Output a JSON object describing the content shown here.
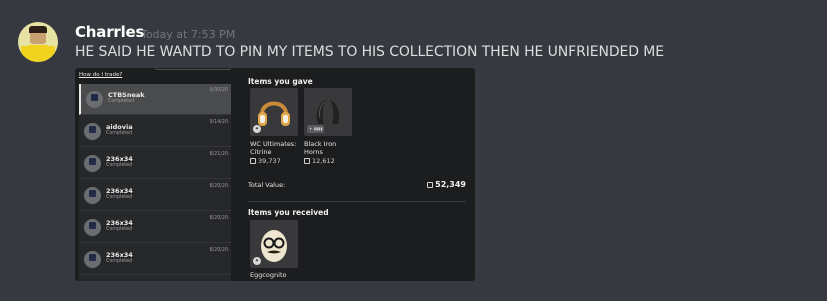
{
  "message": {
    "username": "Charrles",
    "timestamp": "Today at 7:53 PM",
    "text": "HE SAID HE WANTD TO PIN MY ITEMS TO HIS COLLECTION THEN HE UNFRIENDED ME"
  },
  "screenshot": {
    "help_link": "How do I trade?",
    "trades": [
      {
        "name": "CTBSneak",
        "status": "Completed",
        "date": "9/30/20",
        "selected": true
      },
      {
        "name": "aidovia",
        "status": "Completed",
        "date": "9/14/20",
        "selected": false
      },
      {
        "name": "236x34",
        "status": "Completed",
        "date": "8/21/20",
        "selected": false
      },
      {
        "name": "236x34",
        "status": "Completed",
        "date": "8/20/20",
        "selected": false
      },
      {
        "name": "236x34",
        "status": "Completed",
        "date": "8/20/20",
        "selected": false
      },
      {
        "name": "236x34",
        "status": "Completed",
        "date": "8/20/20",
        "selected": false
      }
    ],
    "gave_title": "Items you gave",
    "gave_items": [
      {
        "name": "WC Ultimates: Citrine",
        "value": "39,737"
      },
      {
        "name": "Black Iron Horns",
        "value": "12,612"
      }
    ],
    "total_label": "Total Value:",
    "total_value": "52,349",
    "received_title": "Items you received",
    "received_items": [
      {
        "name": "Eggcognito"
      }
    ],
    "colors": {
      "background": "#36393f",
      "panel": "#1c1d1f",
      "list": "#27282a",
      "selected": "#4a4b4d"
    }
  }
}
